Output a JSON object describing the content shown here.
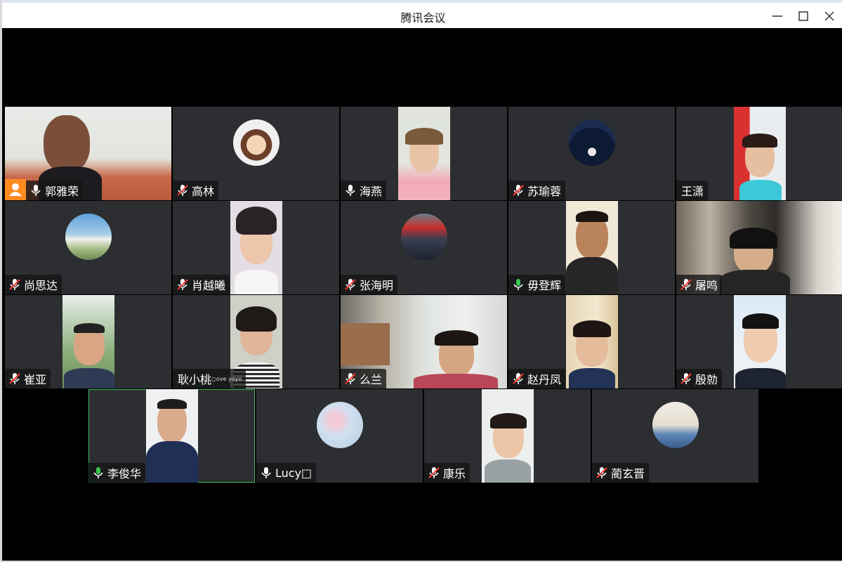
{
  "window": {
    "title": "腾讯会议"
  },
  "controls": {
    "minimize": "minimize-icon",
    "maximize": "maximize-icon",
    "close": "close-icon"
  },
  "colors": {
    "host_badge": "#ff8a1f",
    "active_border": "#3fbd58",
    "speaking_mic": "#37c84f",
    "tile_bg": "#2c2e31"
  },
  "participants": [
    {
      "name": "郭雅荣",
      "mic": "on",
      "host": true
    },
    {
      "name": "高林",
      "mic": "muted"
    },
    {
      "name": "海燕",
      "mic": "on"
    },
    {
      "name": "苏瑜蓉",
      "mic": "muted"
    },
    {
      "name": "王潇",
      "mic": "none"
    },
    {
      "name": "尚思达",
      "mic": "muted"
    },
    {
      "name": "肖越曦",
      "mic": "muted"
    },
    {
      "name": "张海明",
      "mic": "muted"
    },
    {
      "name": "毋登辉",
      "mic": "speaking"
    },
    {
      "name": "屠鸣",
      "mic": "muted"
    },
    {
      "name": "崔亚",
      "mic": "muted"
    },
    {
      "name": "耿小桃",
      "mic": "none",
      "suffix": "○ove yoyo"
    },
    {
      "name": "么兰",
      "mic": "muted"
    },
    {
      "name": "赵丹凤",
      "mic": "muted"
    },
    {
      "name": "殷勍",
      "mic": "muted"
    },
    {
      "name": "李俊华",
      "mic": "speaking",
      "active": true
    },
    {
      "name": "Lucy□",
      "mic": "on"
    },
    {
      "name": "康乐",
      "mic": "muted"
    },
    {
      "name": "蔺玄晋",
      "mic": "muted"
    }
  ]
}
